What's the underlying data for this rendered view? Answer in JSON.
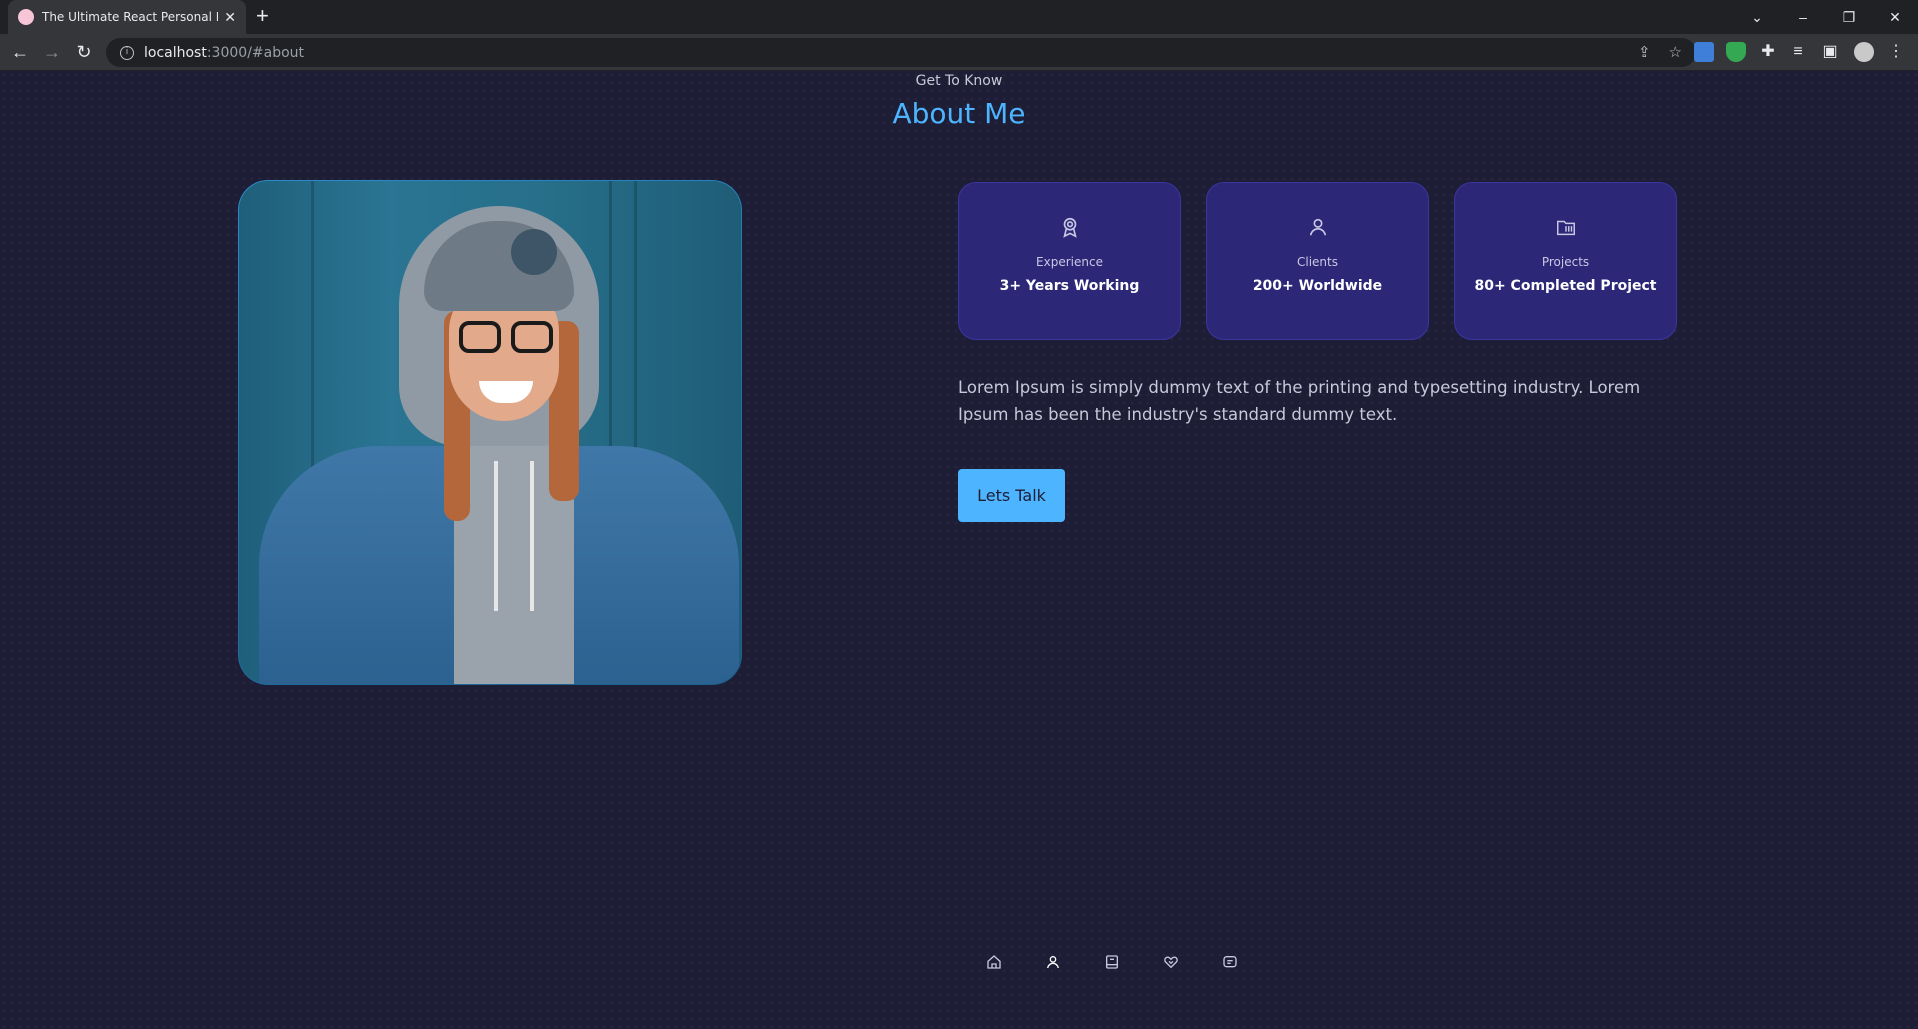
{
  "browser": {
    "tab_title": "The Ultimate React Personal Port",
    "url_host": "localhost",
    "url_rest": ":3000/#about"
  },
  "section": {
    "kicker": "Get To Know",
    "title": "About Me"
  },
  "cards": [
    {
      "icon": "award-icon",
      "label": "Experience",
      "value": "3+ Years Working"
    },
    {
      "icon": "user-icon",
      "label": "Clients",
      "value": "200+ Worldwide"
    },
    {
      "icon": "folder-icon",
      "label": "Projects",
      "value": "80+ Completed Project"
    }
  ],
  "description": "Lorem Ipsum is simply dummy text of the printing and typesetting industry. Lorem Ipsum has been the industry's standard dummy text.",
  "cta_label": "Lets Talk",
  "bottom_nav": [
    "home-icon",
    "user-icon",
    "book-icon",
    "handshake-icon",
    "message-icon"
  ],
  "colors": {
    "background": "#1e1d36",
    "accent": "#4db5ff",
    "card": "#2c2877"
  }
}
